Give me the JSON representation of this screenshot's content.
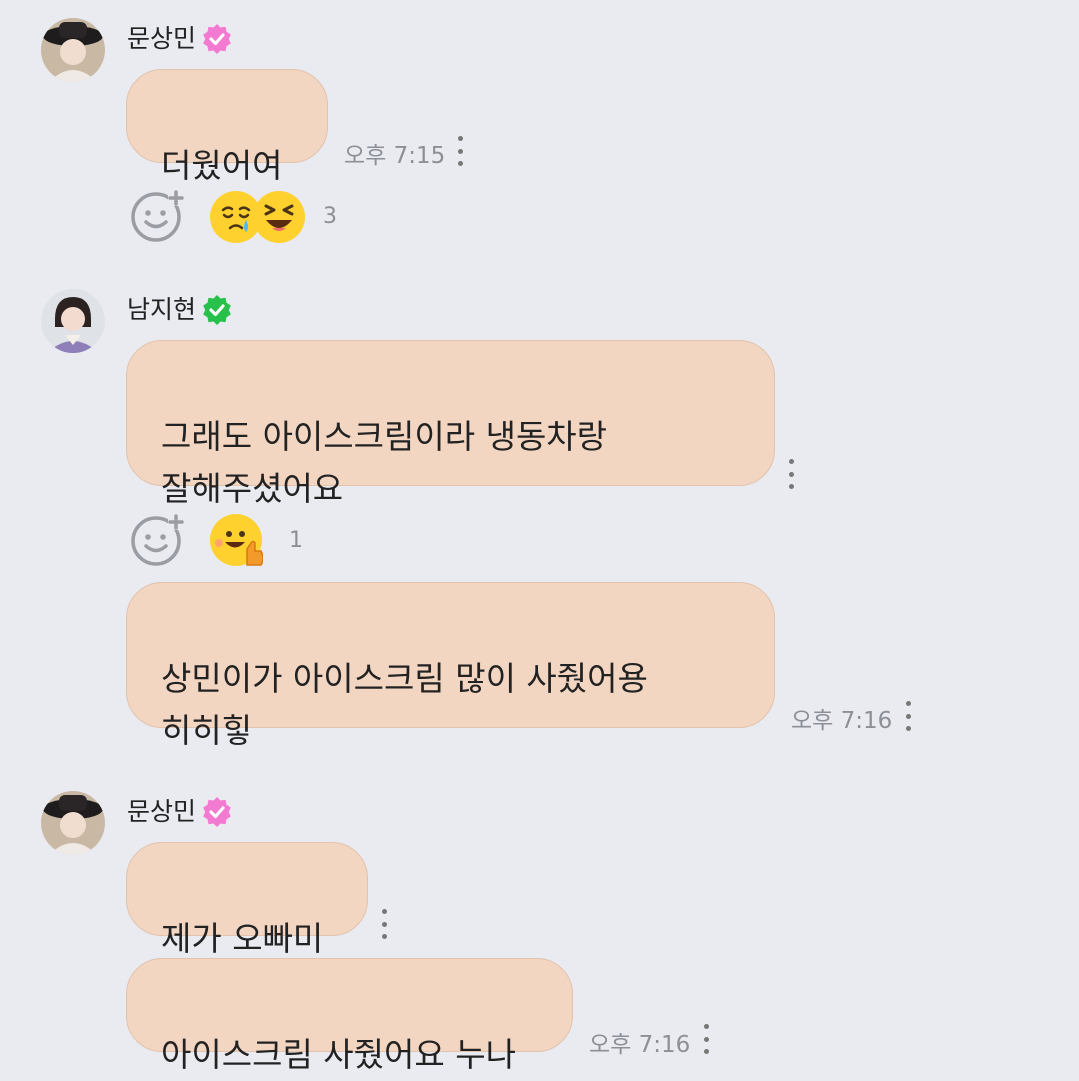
{
  "messages": [
    {
      "sender": "문상민",
      "badge_color": "#f27bd1",
      "bubbles": [
        {
          "text": "더웠어여",
          "time": "오후 7:15"
        }
      ],
      "reactions": {
        "count": "3",
        "emojis": [
          "crying-face",
          "laughing-face"
        ]
      }
    },
    {
      "sender": "남지현",
      "badge_color": "#27c04a",
      "bubbles": [
        {
          "text": "그래도 아이스크림이라 냉동차랑\n잘해주셨어요",
          "time": ""
        },
        {
          "text": "상민이가 아이스크림 많이 사줬어용\n히히힣",
          "time": "오후 7:16"
        }
      ],
      "reactions": {
        "count": "1",
        "emojis": [
          "thumbs-up-face"
        ]
      }
    },
    {
      "sender": "문상민",
      "badge_color": "#f27bd1",
      "bubbles": [
        {
          "text": "제가 오빠미",
          "time": ""
        },
        {
          "text": "아이스크림 사줬어요 누나",
          "time": "오후 7:16"
        }
      ]
    }
  ],
  "colors": {
    "background": "#e9ebf1",
    "bubble": "#f2d6c2",
    "timestamp": "#8c8f96"
  }
}
